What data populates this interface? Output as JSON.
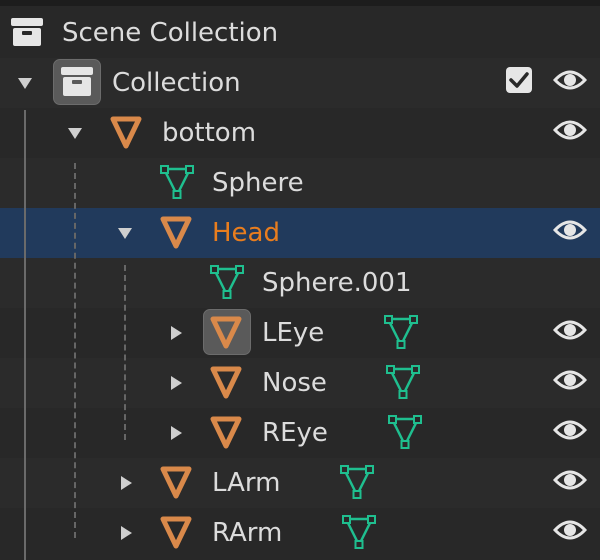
{
  "outliner": {
    "scene_collection": {
      "label": "Scene Collection",
      "icon": "scene-collection-icon"
    },
    "collection": {
      "label": "Collection",
      "checked": true,
      "visible": true,
      "icon": "collection-icon"
    },
    "items": [
      {
        "label": "bottom",
        "type": "empty",
        "expanded": true,
        "visible": true
      },
      {
        "label": "Sphere",
        "type": "mesh-data"
      },
      {
        "label": "Head",
        "type": "empty",
        "expanded": true,
        "visible": true,
        "selected": true,
        "active": true
      },
      {
        "label": "Sphere.001",
        "type": "mesh-data"
      },
      {
        "label": "LEye",
        "type": "empty",
        "expanded": false,
        "visible": true,
        "highlighted_icon": true,
        "has_mesh": true
      },
      {
        "label": "Nose",
        "type": "empty",
        "expanded": false,
        "visible": true,
        "has_mesh": true
      },
      {
        "label": "REye",
        "type": "empty",
        "expanded": false,
        "visible": true,
        "has_mesh": true
      },
      {
        "label": "LArm",
        "type": "empty",
        "expanded": false,
        "visible": true,
        "has_mesh": true
      },
      {
        "label": "RArm",
        "type": "empty",
        "expanded": false,
        "visible": true,
        "has_mesh": true
      }
    ]
  },
  "colors": {
    "background": "#282828",
    "selected_row": "#213a5c",
    "active_text": "#e87d1e",
    "empty_icon": "#d9894a",
    "mesh_icon": "#1fbf8f",
    "text": "#dcdcdc"
  }
}
